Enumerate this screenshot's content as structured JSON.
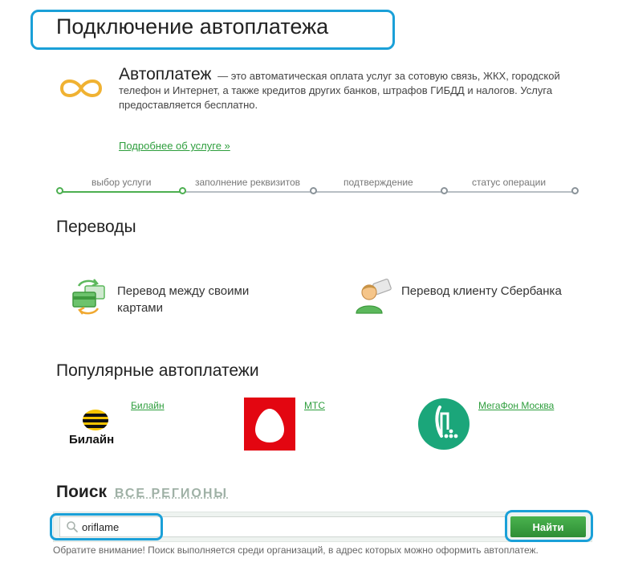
{
  "header": {
    "title": "Подключение автоплатежа"
  },
  "intro": {
    "name": "Автоплатеж",
    "description": "— это автоматическая оплата услуг за сотовую связь, ЖКХ, городской телефон и Интернет, а также кредитов других банков, штрафов ГИБДД и налогов. Услуга предоставляется бесплатно.",
    "more_link": "Подробнее об услуге »"
  },
  "steps": [
    {
      "label": "выбор услуги",
      "active": true
    },
    {
      "label": "заполнение реквизитов",
      "active": false
    },
    {
      "label": "подтверждение",
      "active": false
    },
    {
      "label": "статус операции",
      "active": false
    }
  ],
  "transfers": {
    "title": "Переводы",
    "own_cards": "Перевод между своими картами",
    "to_client": "Перевод клиенту Сбербанка"
  },
  "popular": {
    "title": "Популярные автоплатежи",
    "providers": [
      {
        "name": "Билайн",
        "logo_text": "Билайн",
        "color": "#f5c400"
      },
      {
        "name": "МТС",
        "color": "#e30611"
      },
      {
        "name": "МегаФон Москва",
        "color": "#1ba67a"
      }
    ]
  },
  "search": {
    "title": "Поиск",
    "region": "ВСЕ РЕГИОНЫ",
    "value": "oriflame",
    "button": "Найти",
    "notice": "Обратите внимание! Поиск выполняется среди организаций, в адрес которых можно оформить автоплатеж."
  },
  "colors": {
    "accent": "#2e9e3d",
    "highlight": "#1aa0d8"
  },
  "icons": {
    "autopay": "infinity-icon",
    "own_cards": "cards-transfer-icon",
    "to_client": "person-transfer-icon",
    "search": "search-icon"
  }
}
